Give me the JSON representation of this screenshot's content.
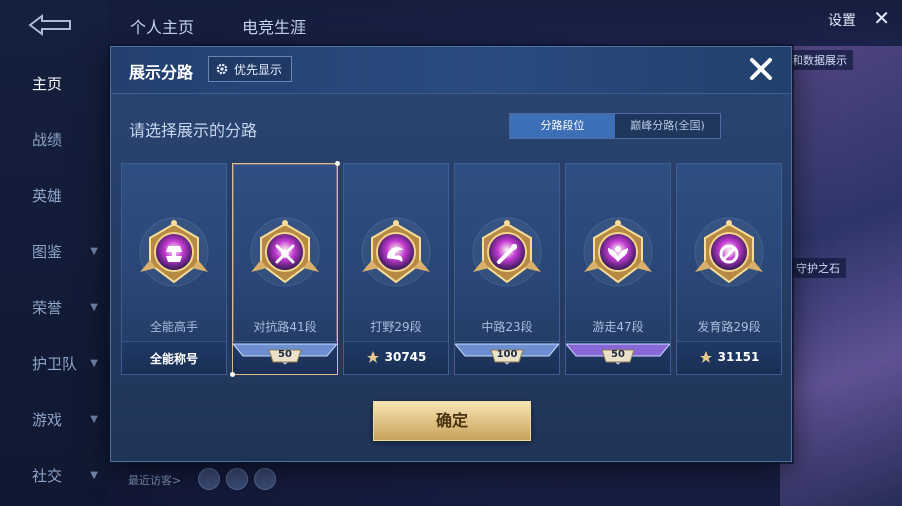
{
  "background": {
    "tabs": [
      "个人主页",
      "电竞生涯"
    ],
    "settings_label": "设置",
    "data_label": "和数据展示",
    "stone_label": "守护之石",
    "visitors_label": "最近访客>",
    "sidebar": [
      {
        "label": "主页",
        "active": true,
        "arrow": false
      },
      {
        "label": "战绩",
        "active": false,
        "arrow": false
      },
      {
        "label": "英雄",
        "active": false,
        "arrow": false
      },
      {
        "label": "图鉴",
        "active": false,
        "arrow": true
      },
      {
        "label": "荣誉",
        "active": false,
        "arrow": true
      },
      {
        "label": "护卫队",
        "active": false,
        "arrow": true
      },
      {
        "label": "游戏",
        "active": false,
        "arrow": true
      },
      {
        "label": "社交",
        "active": false,
        "arrow": true
      }
    ]
  },
  "dialog": {
    "title": "展示分路",
    "priority_button": "优先显示",
    "subtitle": "请选择展示的分路",
    "toggle": {
      "options": [
        "分路段位",
        "巅峰分路(全国)"
      ],
      "active_index": 0
    },
    "confirm_label": "确定",
    "cards": [
      {
        "name": "全能高手",
        "footer_type": "text",
        "footer": "全能称号",
        "medal_color": "#c33ad1",
        "emblem": "swirl-icon",
        "selected": false
      },
      {
        "name": "对抗路41段",
        "footer_type": "ribbon",
        "footer": "50",
        "ribbon_color": "#6b8fd0",
        "medal_color": "#c33ad1",
        "emblem": "crossed-swords-icon",
        "selected": true
      },
      {
        "name": "打野29段",
        "footer_type": "score",
        "footer": "30745",
        "medal_color": "#2a8fe0",
        "emblem": "dragon-icon",
        "selected": false
      },
      {
        "name": "中路23段",
        "footer_type": "ribbon",
        "footer": "100",
        "ribbon_color": "#6b8fd0",
        "medal_color": "#2a8fe0",
        "emblem": "staff-icon",
        "selected": false
      },
      {
        "name": "游走47段",
        "footer_type": "ribbon",
        "footer": "50",
        "ribbon_color": "#8a67d6",
        "medal_color": "#c33ad1",
        "emblem": "wings-icon",
        "selected": false
      },
      {
        "name": "发育路29段",
        "footer_type": "score",
        "footer": "31151",
        "medal_color": "#2a8fe0",
        "emblem": "target-icon",
        "selected": false
      }
    ]
  }
}
